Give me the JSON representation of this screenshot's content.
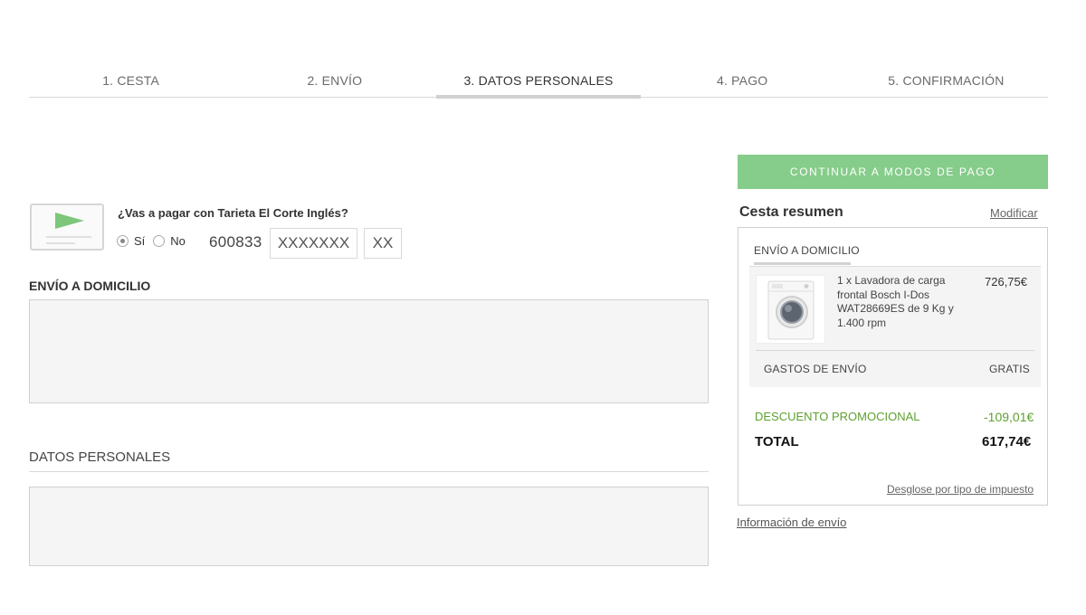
{
  "steps": [
    {
      "label": "1. CESTA"
    },
    {
      "label": "2. ENVÍO"
    },
    {
      "label": "3. DATOS PERSONALES"
    },
    {
      "label": "4. PAGO"
    },
    {
      "label": "5. CONFIRMACIÓN"
    }
  ],
  "active_step": "3. DATOS PERSONALES",
  "card": {
    "icon": "card-play-icon",
    "question": "¿Vas a pagar con Tarieta El Corte Inglés?",
    "option_yes": "Sí",
    "option_no": "No",
    "selected": "Sí",
    "prefix": "600833",
    "middle_value": "XXXXXXX",
    "end_value": "XX"
  },
  "shipping_section": {
    "title": "ENVÍO A DOMICILIO"
  },
  "personal_section": {
    "title": "DATOS PERSONALES"
  },
  "summary": {
    "continue_label": "CONTINUAR A MODOS DE PAGO",
    "title": "Cesta resumen",
    "modify_label": "Modificar",
    "tab_label": "ENVÍO A DOMICILIO",
    "product": {
      "image": "washing-machine-image",
      "description": "1 x Lavadora de carga frontal Bosch I-Dos WAT28669ES de 9 Kg y 1.400 rpm",
      "price": "726,75€"
    },
    "shipping_cost_label": "GASTOS DE ENVÍO",
    "shipping_cost_value": "GRATIS",
    "discount_label": "DESCUENTO PROMOCIONAL",
    "discount_value": "-109,01€",
    "total_label": "TOTAL",
    "total_value": "617,74€",
    "tax_breakdown_link": "Desglose por tipo de impuesto",
    "shipping_info_link": "Información de envío"
  },
  "colors": {
    "accent_button": "#86cc8a",
    "discount_green": "#5fa031",
    "card_icon_green": "#7dc67a"
  }
}
